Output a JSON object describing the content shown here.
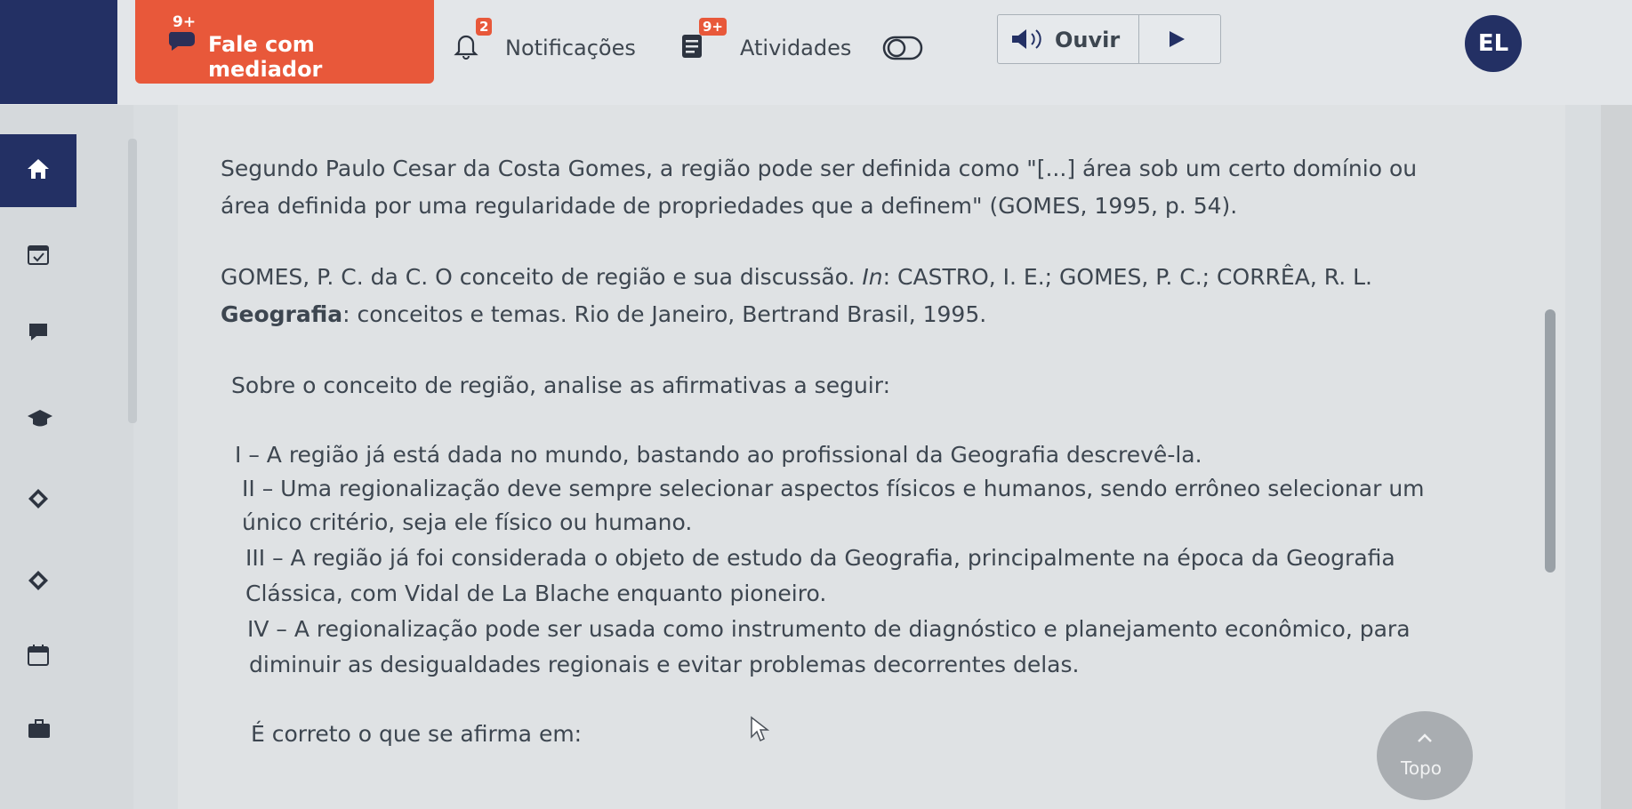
{
  "header": {
    "mediator": {
      "label": "Fale com mediador",
      "badge": "9+"
    },
    "notifications": {
      "label": "Notificações",
      "badge": "2"
    },
    "activities": {
      "label": "Atividades",
      "badge": "9+"
    },
    "listen": {
      "label": "Ouvir"
    },
    "avatar": {
      "initials": "EL"
    }
  },
  "colors": {
    "navy": "#233064",
    "accent": "#e8583a"
  },
  "sidebar": {
    "icons": [
      "home-icon",
      "calendar-check-icon",
      "chat-icon",
      "graduation-cap-icon",
      "diamond-icon",
      "diamond-icon",
      "calendar-icon",
      "briefcase-icon"
    ]
  },
  "content": {
    "intro_line1": "Segundo Paulo Cesar da Costa Gomes, a região pode ser definida como \"[...] área sob um certo domínio ou",
    "intro_line2": "área definida por uma regularidade de propriedades que a definem\" (GOMES, 1995, p. 54).",
    "ref_line1_a": "GOMES, P. C. da C. O conceito de região e sua discussão. ",
    "ref_line1_in": "In",
    "ref_line1_b": ": CASTRO, I. E.; GOMES, P. C.; CORRÊA, R. L.",
    "ref_line2_bold": "Geografia",
    "ref_line2_rest": ": conceitos e temas. Rio de Janeiro, Bertrand Brasil, 1995.",
    "prompt": "Sobre o conceito de região, analise as afirmativas a seguir:",
    "stmt1": "I – A região já está dada no mundo, bastando ao profissional da Geografia descrevê-la.",
    "stmt2_l1": "II – Uma regionalização deve sempre selecionar aspectos físicos e humanos, sendo errôneo selecionar um",
    "stmt2_l2": "único critério, seja ele físico ou humano.",
    "stmt3_l1": "III – A região já foi considerada o objeto de estudo da Geografia, principalmente na época da Geografia",
    "stmt3_l2": "Clássica, com Vidal de La Blache enquanto pioneiro.",
    "stmt4_l1": "IV – A regionalização pode ser usada como instrumento de diagnóstico e planejamento econômico, para",
    "stmt4_l2": "diminuir as desigualdades regionais e evitar problemas decorrentes delas.",
    "question": "É correto o que se afirma em:"
  },
  "topo": {
    "label": "Topo"
  }
}
